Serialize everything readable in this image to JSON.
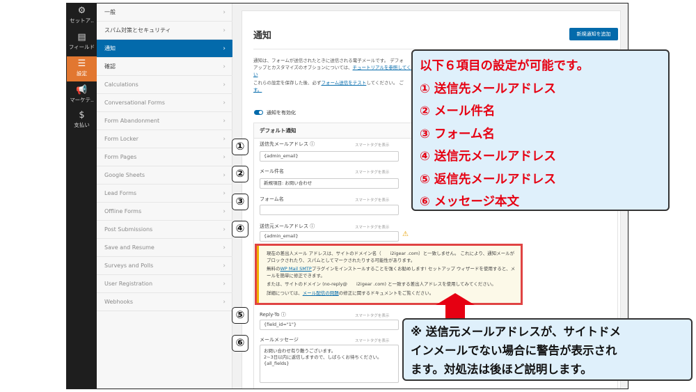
{
  "left_bar": [
    {
      "icon": "gear-icon",
      "label": "セットア..",
      "active": false
    },
    {
      "icon": "fields-icon",
      "label": "フィールド",
      "active": false
    },
    {
      "icon": "settings-sliders-icon",
      "label": "設定",
      "active": true
    },
    {
      "icon": "megaphone-icon",
      "label": "マーケテ..",
      "active": false
    },
    {
      "icon": "dollar-icon",
      "label": "支払い",
      "active": false
    }
  ],
  "subnav": [
    {
      "label": "一般",
      "state": "normal"
    },
    {
      "label": "スパム対策とセキュリティ",
      "state": "normal"
    },
    {
      "label": "通知",
      "state": "active"
    },
    {
      "label": "確認",
      "state": "normal"
    },
    {
      "label": "Calculations",
      "state": "muted"
    },
    {
      "label": "Conversational Forms",
      "state": "muted"
    },
    {
      "label": "Form Abandonment",
      "state": "muted"
    },
    {
      "label": "Form Locker",
      "state": "muted"
    },
    {
      "label": "Form Pages",
      "state": "muted"
    },
    {
      "label": "Google Sheets",
      "state": "muted"
    },
    {
      "label": "Lead Forms",
      "state": "muted"
    },
    {
      "label": "Offline Forms",
      "state": "muted"
    },
    {
      "label": "Post Submissions",
      "state": "muted"
    },
    {
      "label": "Save and Resume",
      "state": "muted"
    },
    {
      "label": "Surveys and Polls",
      "state": "muted"
    },
    {
      "label": "User Registration",
      "state": "muted"
    },
    {
      "label": "Webhooks",
      "state": "muted"
    }
  ],
  "panel": {
    "title": "通知",
    "add_button": "新規通知を追加",
    "desc1_a": "通知は、フォームが送信されたときに送信される電子メールです。 デフォ",
    "desc1_b": "アップとカスタマイズのオプションについては、",
    "desc1_link": "チュートリアルを参照してください",
    "desc2_a": "これらの設定を保存した後、必ず",
    "desc2_link": "フォーム送信をテスト",
    "desc2_b": "してください。 ご",
    "desc2_c": "す。",
    "toggle_label": "通知を有効化",
    "card_title": "デフォルト通知",
    "smart_tag": "スマートタグを表示"
  },
  "fields": [
    {
      "label": "送信先メールアドレス ⓘ",
      "value": "{admin_email}"
    },
    {
      "label": "メール件名",
      "value": "新規項目: お問い合わせ"
    },
    {
      "label": "フォーム名",
      "value": ""
    },
    {
      "label": "送信元メールアドレス ⓘ",
      "value": "{admin_email}"
    },
    {
      "label": "Reply-To ⓘ",
      "value": "{field_id=\"1\"}"
    },
    {
      "label": "メールメッセージ",
      "value": "お問い合わせ有り難うございます。\n2~3日以内に返信しますので、しばらくお待ちください。\n{all_fields}"
    }
  ],
  "warning": {
    "line1": "現在の差出人メール アドレスは、サイトのドメイン名（　　i2igear .com）と一致しません。 これにより、通知メールがブロックされたり、スパムとしてマークされたりする可能性があります。",
    "line2_a": "無料の",
    "line2_link": "WP Mail SMTP",
    "line2_b": "プラグインをインストールすることを強くお勧めします! セットアップ ウィザードを使用すると、メールを簡単に修正できます。",
    "line3": "または、サイトのドメイン (no-reply@　　i2igear .com) と一致する差出人アドレスを使用してみてください。",
    "line4_a": "詳細については、",
    "line4_link": "メール配信の問題",
    "line4_b": "の修正に関するドキュメントをご覧ください。"
  },
  "markers": [
    "①",
    "②",
    "③",
    "④",
    "⑤",
    "⑥"
  ],
  "callout_items": {
    "heading": "以下６項目の設定が可能です。",
    "items": [
      "① 送信先メールアドレス",
      "② メール件名",
      "③ フォーム名",
      "④ 送信元メールアドレス",
      "⑤ 返信先メールアドレス",
      "⑥ メッセージ本文"
    ]
  },
  "callout_note": {
    "line1": "※ 送信元メールアドレスが、サイトドメ",
    "line2": "インメールでない場合に警告が表示され",
    "line3": "ます。対処法は後ほど説明します。"
  },
  "colors": {
    "accent_blue": "#036aab",
    "settings_orange": "#e27730",
    "callout_red": "#e60012",
    "callout_bg": "#dff0fb"
  }
}
